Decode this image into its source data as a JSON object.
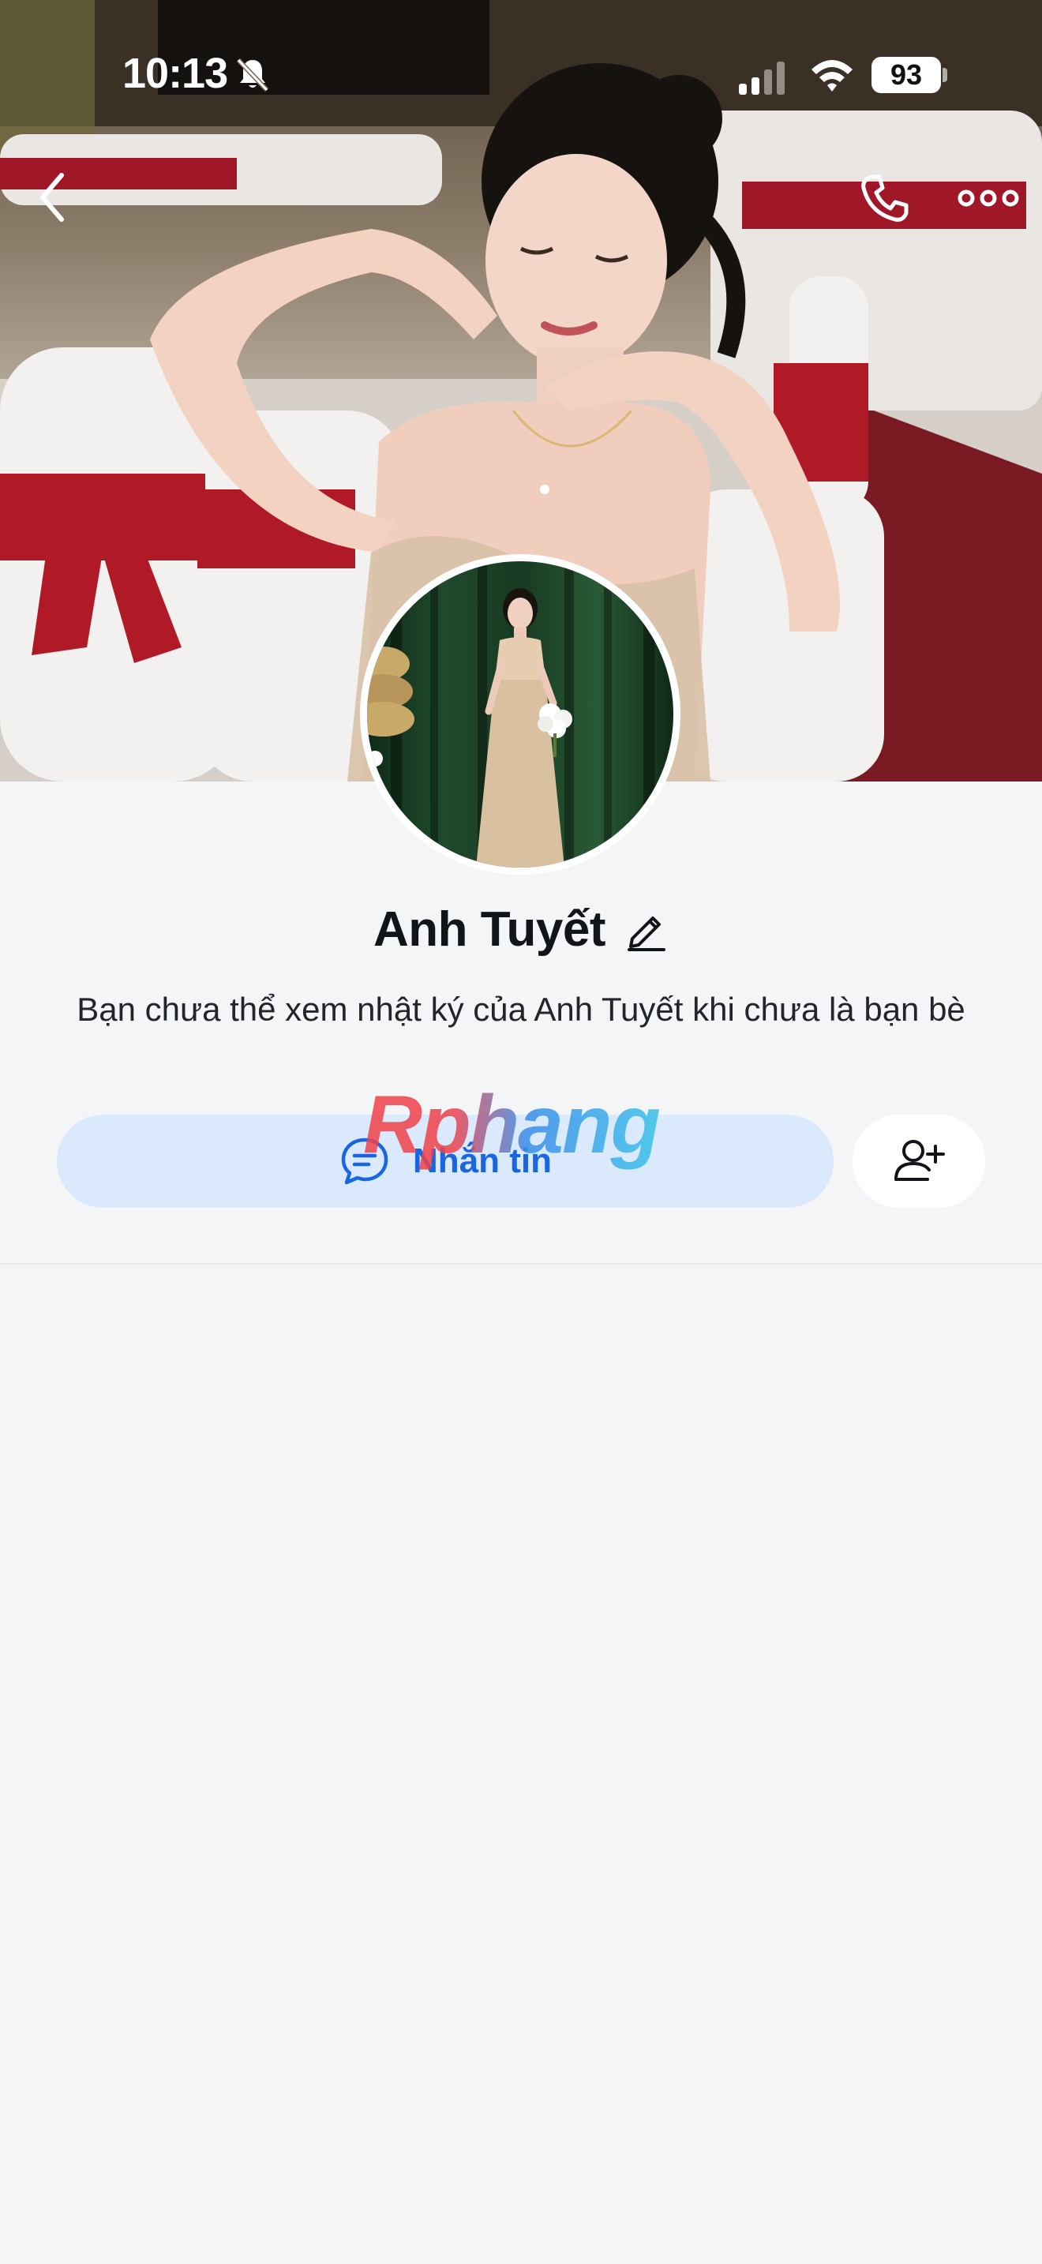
{
  "status_bar": {
    "time": "10:13",
    "battery": "93",
    "icons": [
      "bell-slash-icon",
      "signal-icon",
      "wifi-icon",
      "battery-icon"
    ]
  },
  "nav": {
    "back_icon": "chevron-left-icon",
    "call_icon": "phone-icon",
    "more_icon": "more-horizontal-icon"
  },
  "profile": {
    "name": "Anh Tuyết",
    "edit_icon": "pencil-icon",
    "notice": "Bạn chưa thể xem nhật ký của Anh Tuyết khi chưa là bạn bè"
  },
  "actions": {
    "message_label": "Nhắn tin",
    "message_icon": "chat-bubble-icon",
    "add_friend_icon": "add-user-icon"
  },
  "watermark": "Rphang",
  "colors": {
    "page_bg": "#f4f5f7",
    "message_button_bg": "#dbe9fd",
    "accent_blue": "#1a66e0",
    "text_primary": "#111418"
  }
}
